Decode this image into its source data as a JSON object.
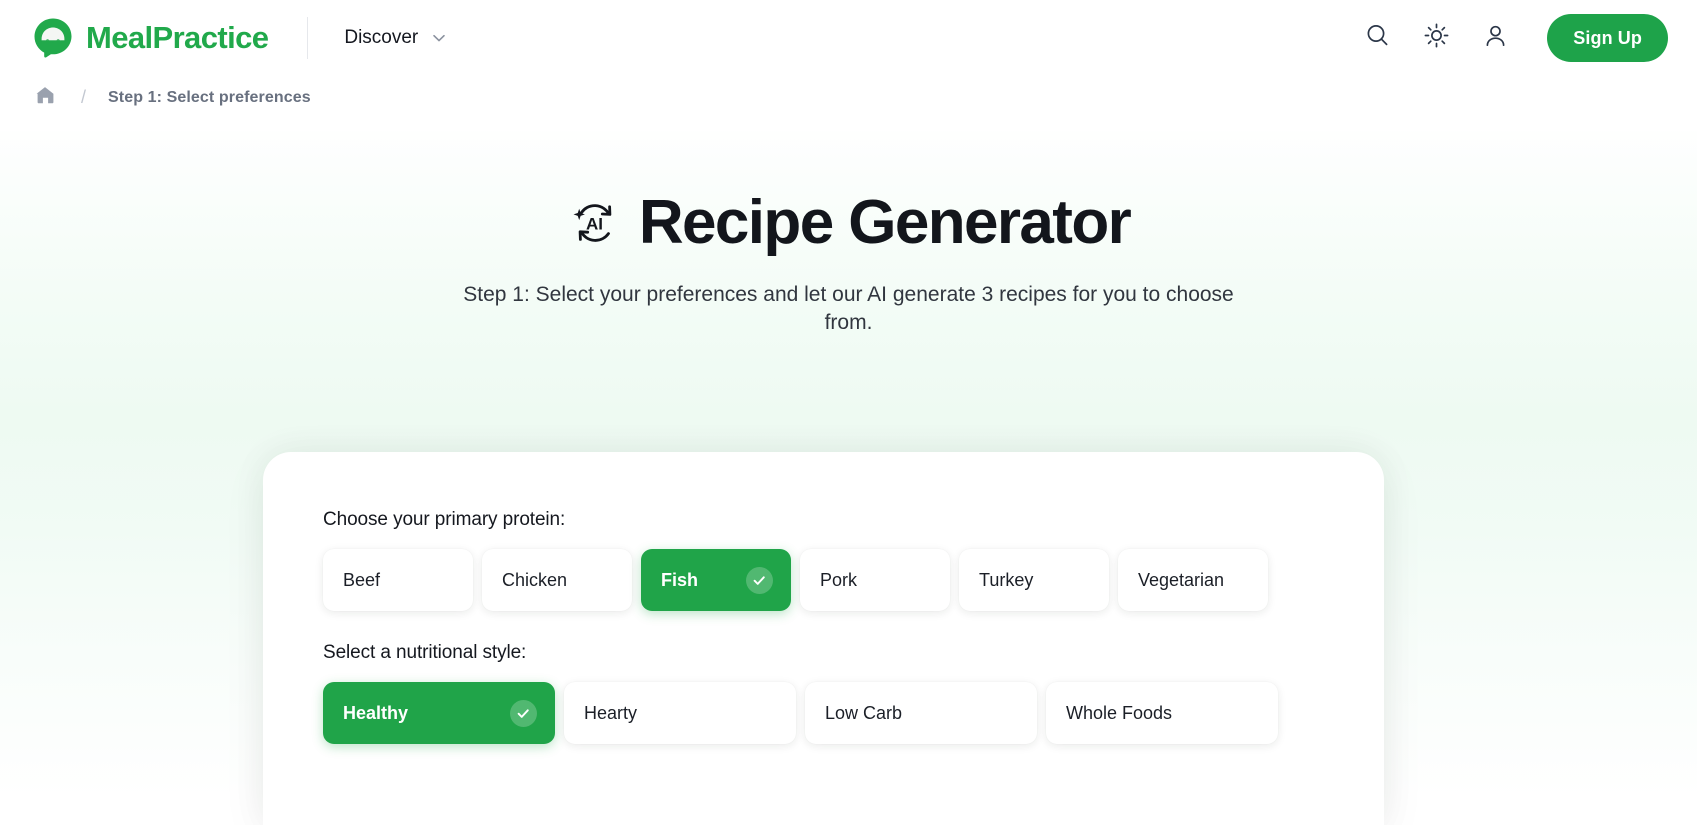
{
  "brand": {
    "name": "MealPractice",
    "logo_icon": "mealpractice-logo-icon",
    "accent_color": "#21a94b"
  },
  "topbar": {
    "nav": [
      {
        "label": "Discover",
        "icon": "chevron-down-icon",
        "has_dropdown": true
      }
    ],
    "actions": [
      {
        "icon": "search-icon",
        "name": "search-button"
      },
      {
        "icon": "sun-icon",
        "name": "theme-toggle-button"
      },
      {
        "icon": "user-icon",
        "name": "account-button"
      }
    ],
    "signup_label": "Sign Up"
  },
  "breadcrumb": {
    "home_icon": "home-icon",
    "separator": "/",
    "current": "Step 1: Select preferences"
  },
  "hero": {
    "title_icon": "ai-refresh-icon",
    "title": "Recipe Generator",
    "subtitle": "Step 1: Select your preferences and let our AI generate 3 recipes for you to choose from."
  },
  "form": {
    "protein": {
      "label": "Choose your primary protein:",
      "options": [
        {
          "label": "Beef",
          "selected": false
        },
        {
          "label": "Chicken",
          "selected": false
        },
        {
          "label": "Fish",
          "selected": true
        },
        {
          "label": "Pork",
          "selected": false
        },
        {
          "label": "Turkey",
          "selected": false
        },
        {
          "label": "Vegetarian",
          "selected": false
        }
      ]
    },
    "nutrition": {
      "label": "Select a nutritional style:",
      "options": [
        {
          "label": "Healthy",
          "selected": true
        },
        {
          "label": "Hearty",
          "selected": false
        },
        {
          "label": "Low Carb",
          "selected": false
        },
        {
          "label": "Whole Foods",
          "selected": false
        }
      ]
    },
    "selected_icon": "check-circle-icon"
  },
  "colors": {
    "brand_green": "#21a94b",
    "selected_green": "#20a449",
    "page_background": "#ffffff",
    "hero_tint": "#eefaf2"
  }
}
